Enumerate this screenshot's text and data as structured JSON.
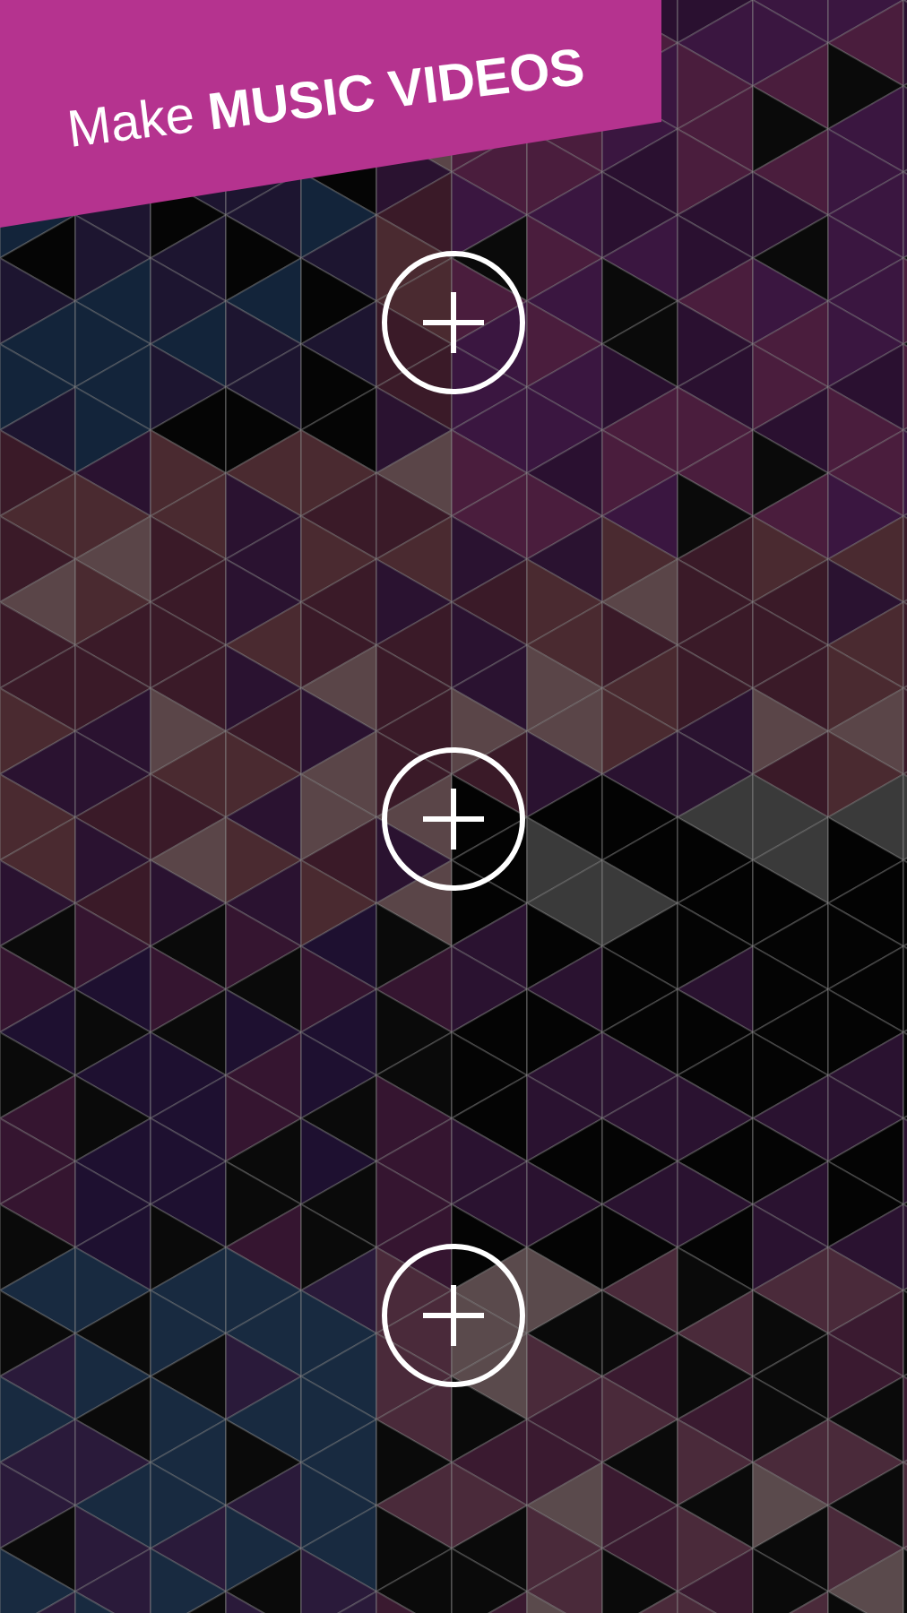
{
  "banner": {
    "text": "Make **MUSIC VIDEOS**"
  }
}
